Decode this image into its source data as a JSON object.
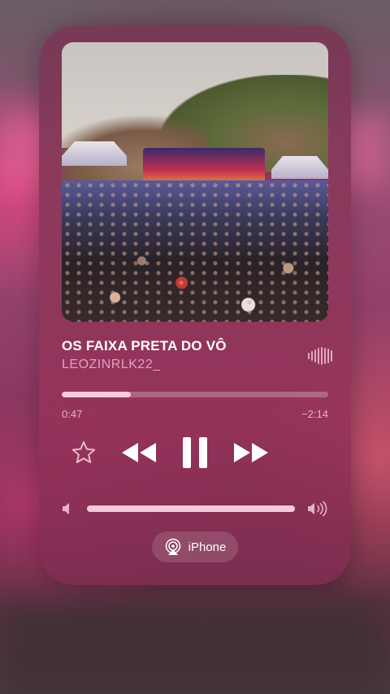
{
  "now_playing": {
    "title": "OS FAIXA PRETA DO VÔ",
    "artist": "LEOZINRLK22_",
    "elapsed": "0:47",
    "remaining": "−2:14",
    "progress": 0.26,
    "volume": 1.0,
    "output_device": "iPhone"
  },
  "icons": {
    "favorite": "star-icon",
    "rewind": "rewind-icon",
    "pause": "pause-icon",
    "fast_forward": "fast-forward-icon",
    "volume_low": "speaker-low-icon",
    "volume_high": "speaker-high-icon",
    "airplay": "airplay-icon",
    "waveform": "waveform-icon"
  },
  "colors": {
    "card": "#8c3760",
    "accent": "#f4c4d8",
    "text": "#ffffff"
  }
}
